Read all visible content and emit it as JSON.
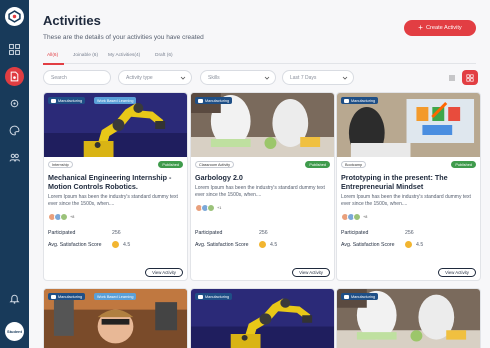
{
  "header": {
    "title": "Activities",
    "subtitle": "These are the details of your activities you have created",
    "create_label": "Create Activity"
  },
  "tabs": [
    {
      "label": "All(6)"
    },
    {
      "label": "Joinable (6)"
    },
    {
      "label": "My Activities(4)"
    },
    {
      "label": "Draft (6)"
    }
  ],
  "filters": {
    "search_placeholder": "Search",
    "activity_type": "Activity type",
    "skills": "Skills",
    "date_range": "Last 7 Days"
  },
  "sidebar": {
    "avatar_text": "Student"
  },
  "labels": {
    "participated": "Participated",
    "satisfaction": "Avg. Satisfaction Score",
    "view": "View Activity",
    "published": "Published"
  },
  "cards": [
    {
      "category": "Manufacturing",
      "badge": "Work Based Learning",
      "type": "Internship",
      "title": "Mechanical Engineering Internship - Motion Controls Robotics.",
      "desc": "Lorem Ipsum has been the industry's standard dummy text ever since the 1500s, when....",
      "more": "+8",
      "participated": "256",
      "score": "4.5",
      "image": "robot"
    },
    {
      "category": "Manufacturing",
      "badge": "",
      "type": "Classroom Activity",
      "title": "Garbology 2.0",
      "desc": "Lorem Ipsum has been the industry's standard dummy text ever since the 1500s, when....",
      "more": "+1",
      "participated": "256",
      "score": "4.5",
      "image": "lab"
    },
    {
      "category": "Manufacturing",
      "badge": "",
      "type": "Bootcamp",
      "title": "Prototyping in the present: The Entrepreneurial Mindset",
      "desc": "Lorem Ipsum has been the industry's standard dummy text ever since the 1500s, when....",
      "more": "+8",
      "participated": "256",
      "score": "4.5",
      "image": "proto"
    }
  ],
  "bottom_cards": [
    {
      "category": "Manufacturing",
      "badge": "Work Based Learning",
      "image": "kid"
    },
    {
      "category": "Manufacturing",
      "badge": "",
      "image": "robot"
    },
    {
      "category": "Manufacturing",
      "badge": "",
      "image": "lab"
    }
  ],
  "colors": {
    "sidebar": "#183a5a",
    "accent": "#e23e43",
    "published": "#3f9b4c",
    "chip": "#1f4f86"
  }
}
